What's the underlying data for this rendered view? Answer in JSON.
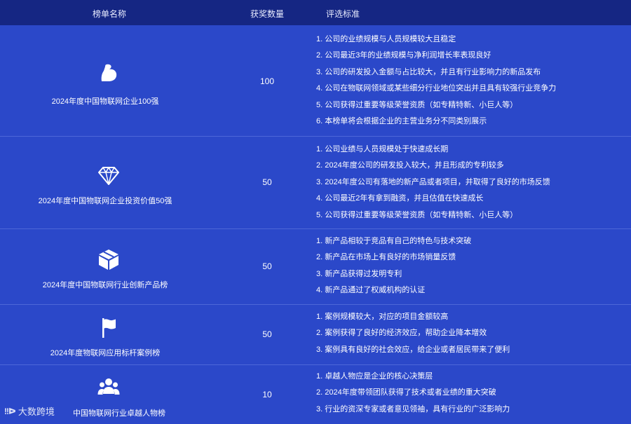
{
  "header": {
    "name_label": "榜单名称",
    "count_label": "获奖数量",
    "criteria_label": "评选标准"
  },
  "rows": [
    {
      "icon": "flexed-arm-icon",
      "name": "2024年度中国物联网企业100强",
      "count": "100",
      "criteria": [
        "1. 公司的业绩规模与人员规模较大且稳定",
        "2. 公司最近3年的业绩规模与净利润增长率表现良好",
        "3. 公司的研发投入金额与占比较大，并且有行业影响力的新品发布",
        "4. 公司在物联网领域或某些细分行业地位突出并且具有较强行业竞争力",
        "5. 公司获得过重要等级荣誉资质（如专精特新、小巨人等）",
        "6. 本榜单将会根据企业的主营业务分不同类别展示"
      ]
    },
    {
      "icon": "diamond-icon",
      "name": "2024年度中国物联网企业投资价值50强",
      "count": "50",
      "criteria": [
        "1. 公司业绩与人员规模处于快速成长期",
        "2. 2024年度公司的研发投入较大，并且形成的专利较多",
        "3. 2024年度公司有落地的新产品或者项目，并取得了良好的市场反馈",
        "4. 公司最近2年有拿到融资，并且估值在快速成长",
        "5. 公司获得过重要等级荣誉资质（如专精特新、小巨人等）"
      ]
    },
    {
      "icon": "box-icon",
      "name": "2024年度中国物联网行业创新产品榜",
      "count": "50",
      "criteria": [
        "1. 新产品相较于竞品有自己的特色与技术突破",
        "2. 新产品在市场上有良好的市场销量反馈",
        "3. 新产品获得过发明专利",
        "4. 新产品通过了权威机构的认证"
      ]
    },
    {
      "icon": "flag-icon",
      "name": "2024年度物联网应用标杆案例榜",
      "count": "50",
      "criteria": [
        "1. 案例规模较大，对应的项目金额较高",
        "2. 案例获得了良好的经济效应，帮助企业降本增效",
        "3. 案例具有良好的社会效应，给企业或者居民带来了便利"
      ]
    },
    {
      "icon": "people-group-icon",
      "name": "中国物联网行业卓越人物榜",
      "count": "10",
      "criteria": [
        "1. 卓越人物应是企业的核心决策层",
        "2. 2024年度带领团队获得了技术或者业绩的重大突破",
        "3. 行业的资深专家或者意见领袖，具有行业的广泛影响力"
      ]
    }
  ],
  "watermark": {
    "logo": "!!ᐅ",
    "text": "大数跨境"
  }
}
